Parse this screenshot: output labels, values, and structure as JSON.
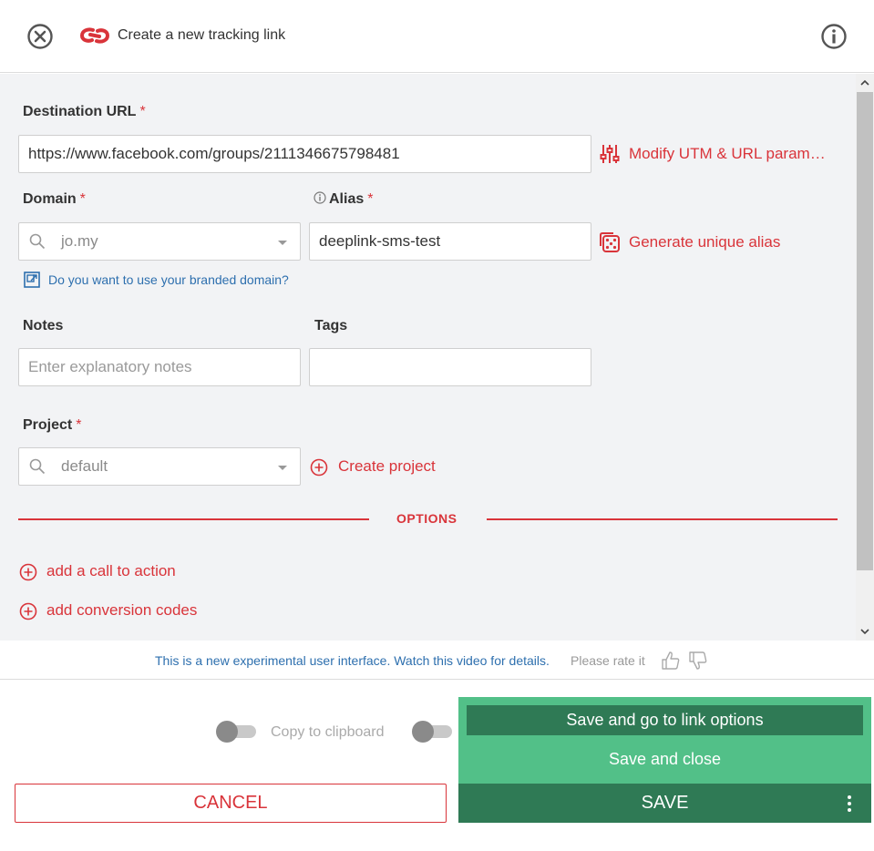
{
  "header": {
    "title": "Create a new tracking link"
  },
  "form": {
    "destination": {
      "label": "Destination URL",
      "required": "*",
      "value": "https://www.facebook.com/groups/2111346675798481",
      "modify_link": "Modify UTM & URL param…"
    },
    "domain": {
      "label": "Domain",
      "required": "*",
      "value": "jo.my",
      "branded_link": "Do you want to use your branded domain?"
    },
    "alias": {
      "label": "Alias",
      "required": "*",
      "value": "deeplink-sms-test",
      "generate_link": "Generate unique alias"
    },
    "notes": {
      "label": "Notes",
      "placeholder": "Enter explanatory notes",
      "value": ""
    },
    "tags": {
      "label": "Tags",
      "value": ""
    },
    "project": {
      "label": "Project",
      "required": "*",
      "value": "default",
      "create_link": "Create project"
    },
    "options": {
      "label": "OPTIONS",
      "call_to_action": "add a call to action",
      "conversion_codes": "add conversion codes"
    }
  },
  "feedback": {
    "text": "This is a new experimental user interface. Watch this video for details.",
    "rate": "Please rate it"
  },
  "footer": {
    "copy_label": "Copy to clipboard",
    "dropdown": {
      "item1": "Save and go to link options",
      "item2": "Save and close"
    },
    "cancel_label": "CANCEL",
    "save_label": "SAVE"
  },
  "colors": {
    "accent_red": "#d9343a",
    "save_green": "#2f7a55",
    "dropdown_green": "#52c088",
    "link_blue": "#2d6fae",
    "panel_bg": "#f2f3f5"
  }
}
